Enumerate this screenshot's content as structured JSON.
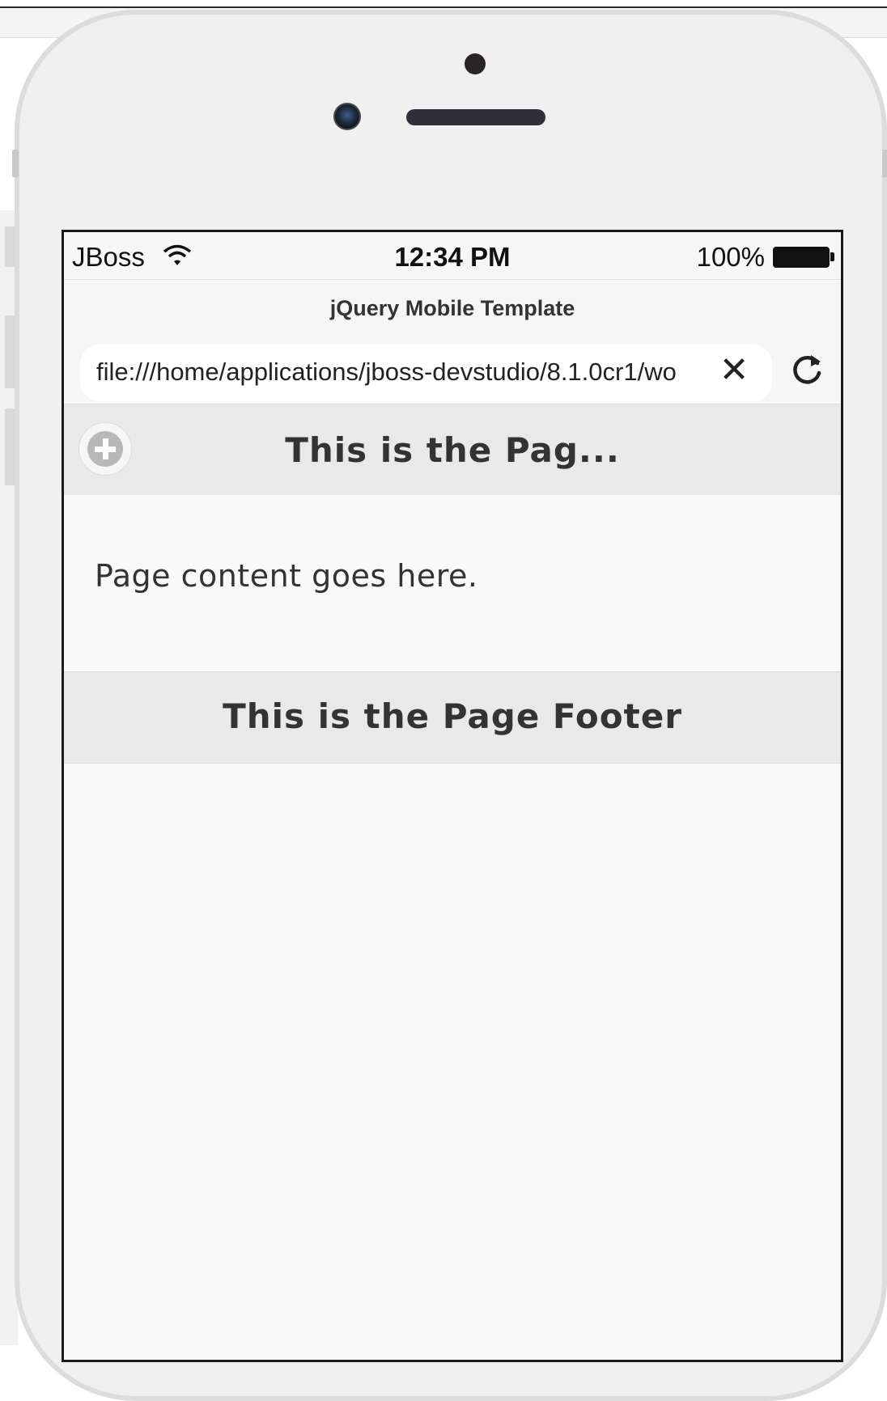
{
  "status_bar": {
    "carrier": "JBoss",
    "time": "12:34 PM",
    "battery_percent": "100%"
  },
  "browser": {
    "page_title": "jQuery Mobile Template",
    "url": "file:///home/applications/jboss-devstudio/8.1.0cr1/wo",
    "clear_icon": "close-icon",
    "reload_icon": "reload-icon"
  },
  "app": {
    "header_title": "This is the Pag...",
    "header_button_icon": "add-icon",
    "content_text": "Page content goes here.",
    "footer_title": "This is the Page Footer"
  },
  "colors": {
    "toolbar_bg": "#e9e9e9",
    "page_bg": "#f9f9f9",
    "phone_body": "#efefef"
  }
}
